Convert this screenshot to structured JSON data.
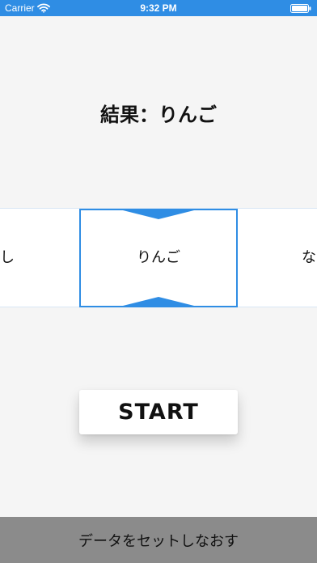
{
  "status_bar": {
    "carrier": "Carrier",
    "time": "9:32 PM",
    "background_color": "#2f8de4",
    "icons": [
      "wifi-icon",
      "battery-icon"
    ]
  },
  "result": {
    "text": "結果：りんご"
  },
  "reel": {
    "items": [
      "し",
      "りんご",
      "な"
    ],
    "selected_index": 1,
    "accent_color": "#2f8de4"
  },
  "buttons": {
    "start_label": "START",
    "reset_label": "データをセットしなおす"
  }
}
